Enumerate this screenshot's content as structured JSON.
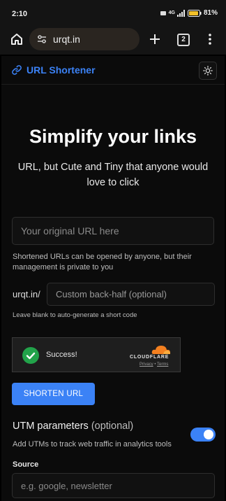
{
  "status_bar": {
    "time": "2:10",
    "network": "4G",
    "battery": "81%"
  },
  "browser": {
    "url": "urqt.in",
    "tab_count": "2"
  },
  "header": {
    "brand": "URL Shortener",
    "brand_icon": "link-icon",
    "theme_icon": "sun-icon"
  },
  "hero": {
    "title": "Simplify your links",
    "subtitle": "URL, but Cute and Tiny that anyone would love to click"
  },
  "form": {
    "url_placeholder": "Your original URL here",
    "url_help": "Shortened URLs can be opened by anyone, but their management is private to you",
    "domain_prefix": "urqt.in/",
    "backhalf_placeholder": "Custom back-half (optional)",
    "backhalf_help": "Leave blank to auto-generate a short code",
    "captcha": {
      "status": "Success!",
      "brand": "CLOUDFLARE",
      "privacy": "Privacy",
      "separator": "•",
      "terms": "Terms"
    },
    "submit_label": "SHORTEN URL"
  },
  "utm": {
    "title": "UTM parameters",
    "optional": "(optional)",
    "description": "Add UTMs to track web traffic in analytics tools",
    "enabled": true,
    "source_label": "Source",
    "source_placeholder": "e.g. google, newsletter"
  },
  "colors": {
    "accent": "#3b82f6",
    "success": "#22a34a",
    "cloudflare": "#f38020"
  }
}
